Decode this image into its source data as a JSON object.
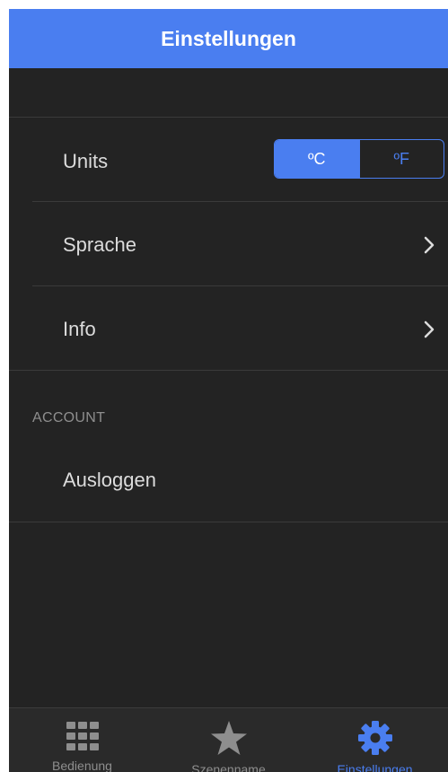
{
  "header": {
    "title": "Einstellungen"
  },
  "settings": {
    "units_label": "Units",
    "units_options": [
      "ºC",
      "ºF"
    ],
    "units_selected": "ºC",
    "language_label": "Sprache",
    "info_label": "Info"
  },
  "account": {
    "section_header": "ACCOUNT",
    "logout_label": "Ausloggen"
  },
  "tabbar": {
    "items": [
      {
        "label": "Bedienung",
        "icon": "grid-icon",
        "active": false
      },
      {
        "label": "Szenenname",
        "icon": "star-icon",
        "active": false
      },
      {
        "label": "Einstellungen",
        "icon": "gear-icon",
        "active": true
      }
    ]
  },
  "colors": {
    "accent": "#4a7ef0",
    "background": "#232323",
    "text": "#dcdcdc",
    "inactive_tab": "#8e8e8e"
  }
}
